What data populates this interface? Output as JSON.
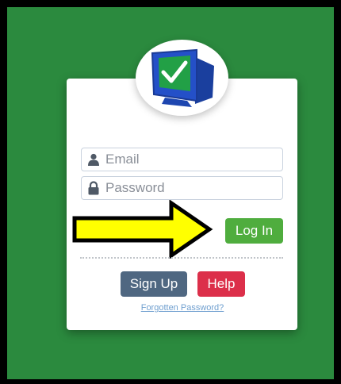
{
  "login_card": {
    "email_placeholder": "Email",
    "password_placeholder": "Password",
    "login_label": "Log In",
    "signup_label": "Sign Up",
    "help_label": "Help",
    "forgot_password_link": "Forgotten Password?"
  },
  "icons": {
    "logo": "monitor-checkmark-icon",
    "email": "user-icon",
    "password": "lock-icon",
    "annotation": "arrow-right-icon"
  },
  "colors": {
    "background": "#2b8a3e",
    "frame": "#000000",
    "login_button": "#4fad3e",
    "signup_button": "#4f6781",
    "help_button": "#dc2f4a",
    "link": "#6f9fcf",
    "arrow_fill": "#ffff00"
  }
}
